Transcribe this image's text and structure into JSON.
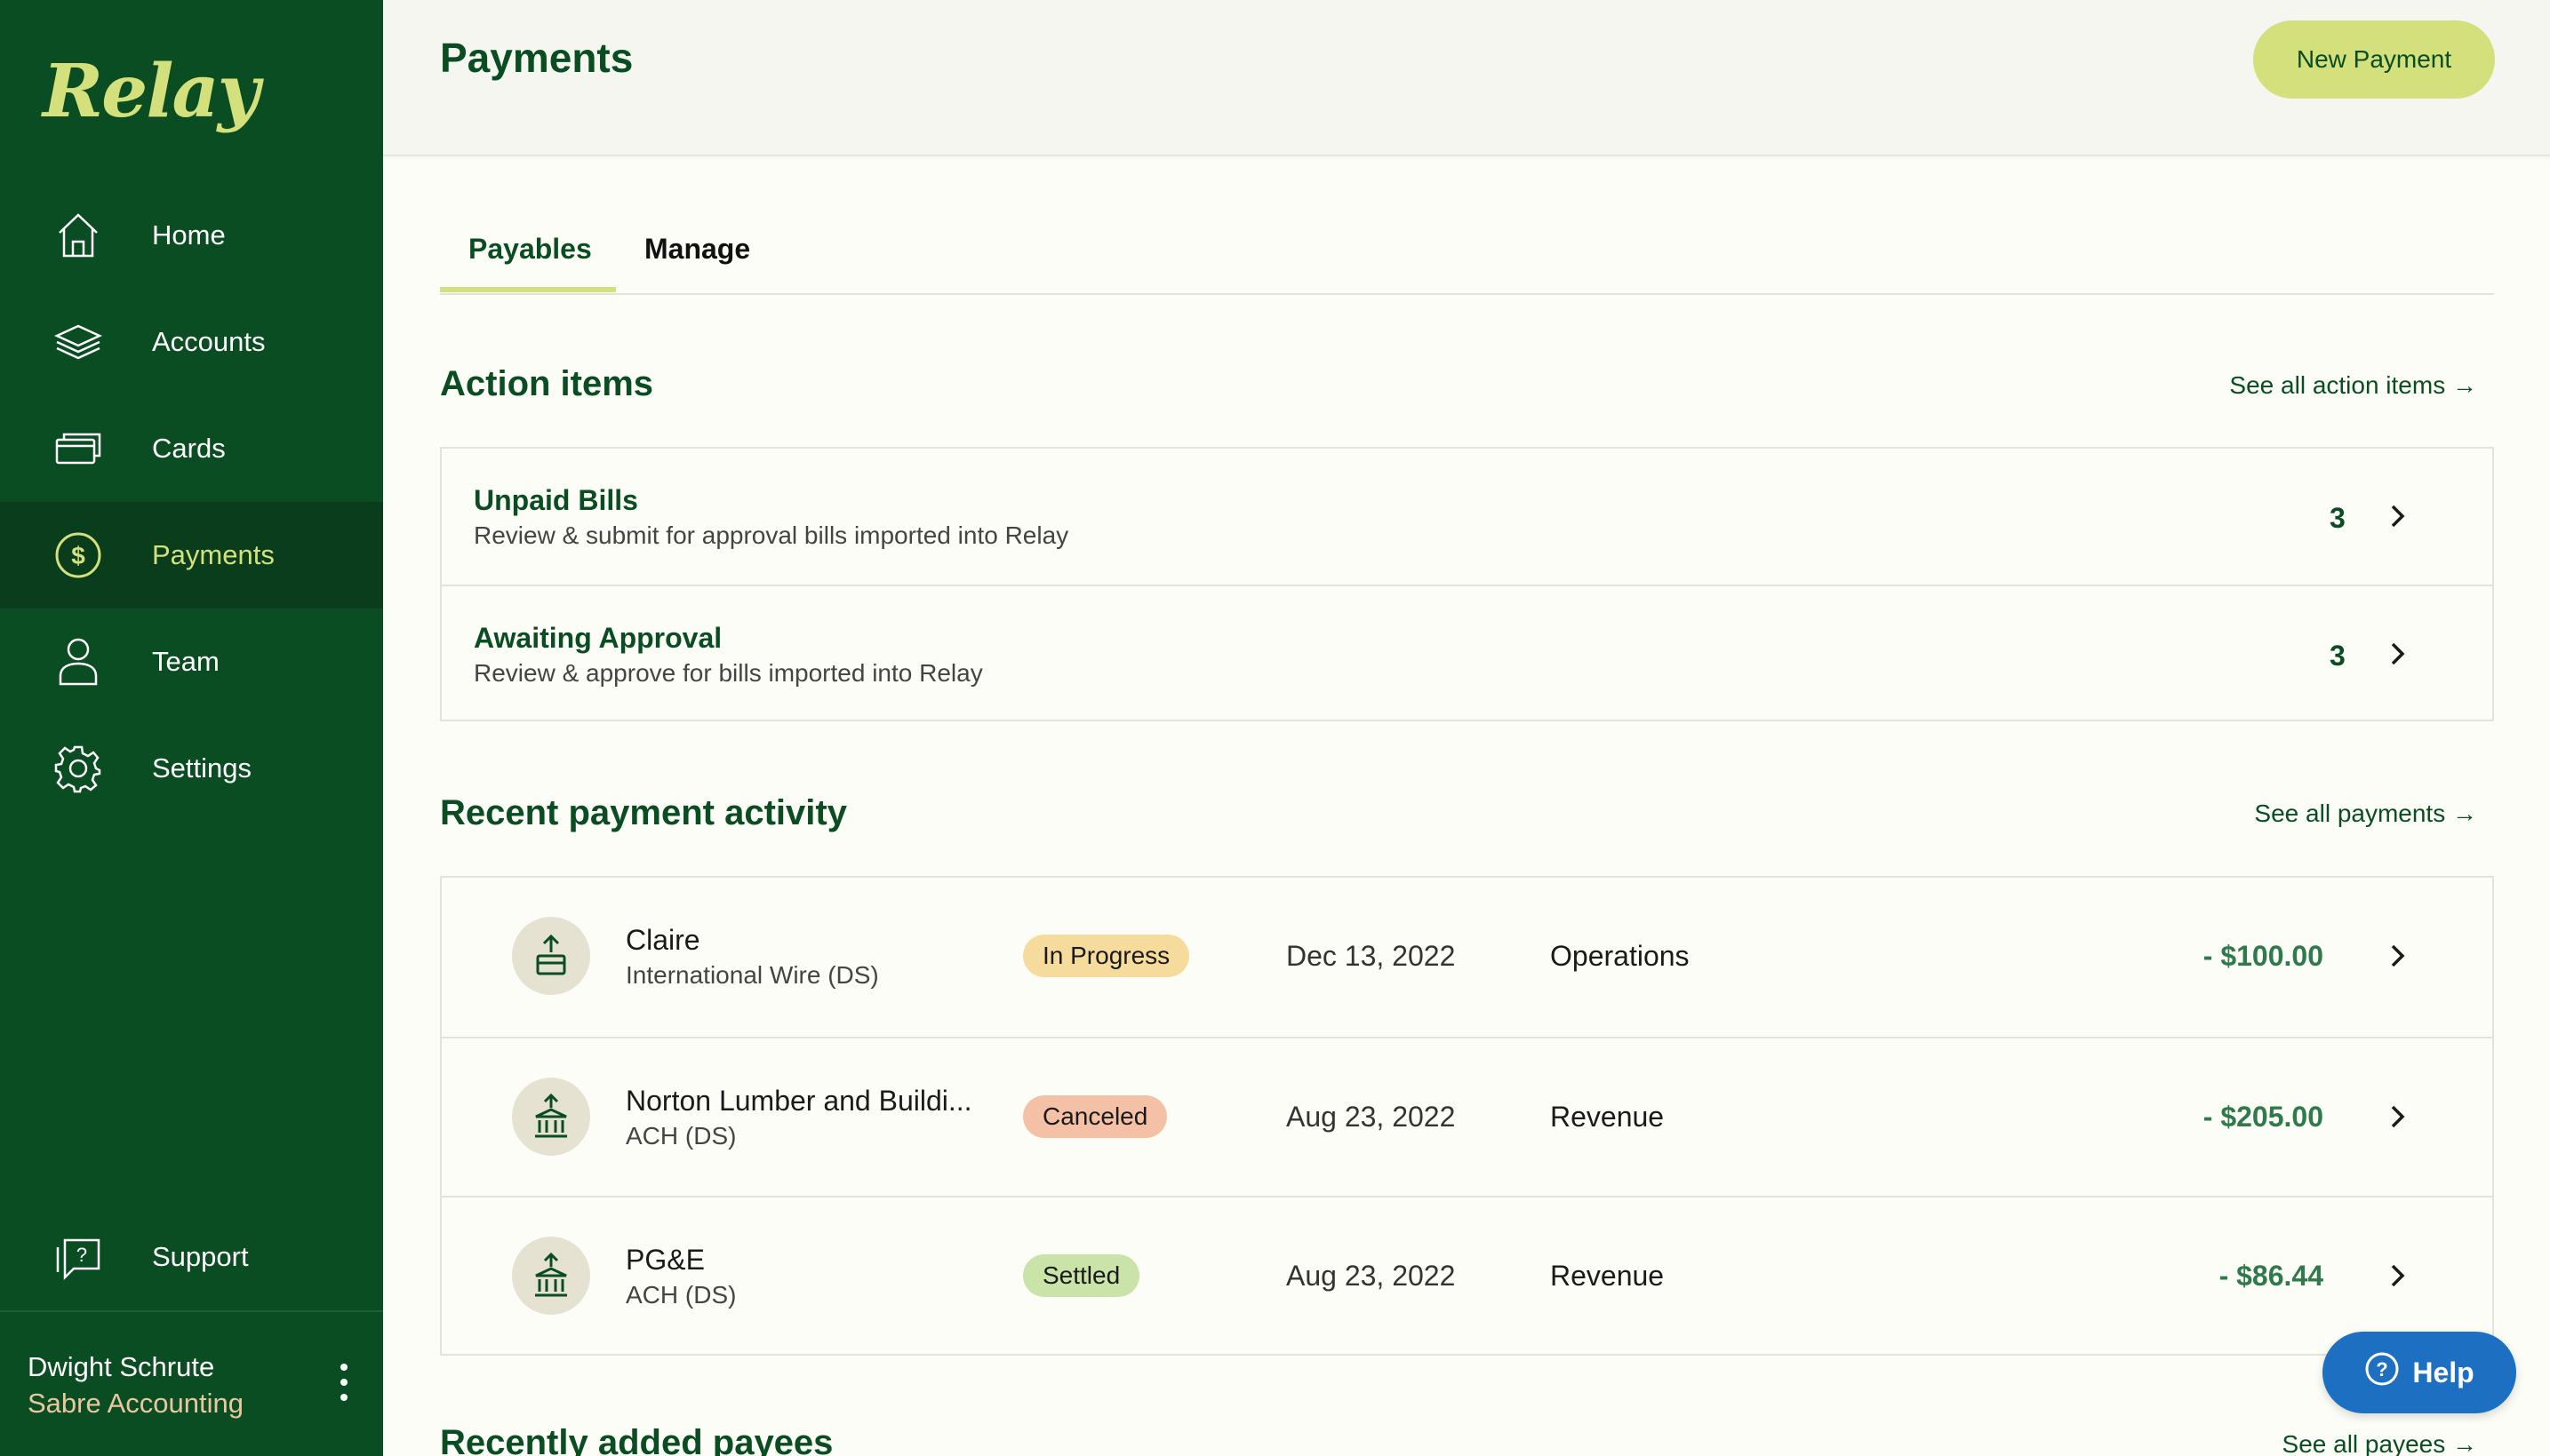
{
  "sidebar": {
    "logo": "Relay",
    "items": [
      {
        "label": "Home",
        "icon": "home-icon"
      },
      {
        "label": "Accounts",
        "icon": "layers-icon"
      },
      {
        "label": "Cards",
        "icon": "cards-icon"
      },
      {
        "label": "Payments",
        "icon": "dollar-circle-icon",
        "active": true
      },
      {
        "label": "Team",
        "icon": "person-icon"
      },
      {
        "label": "Settings",
        "icon": "gear-icon"
      }
    ],
    "support": {
      "label": "Support",
      "icon": "help-chat-icon"
    },
    "user": {
      "name": "Dwight Schrute",
      "org": "Sabre Accounting"
    }
  },
  "header": {
    "title": "Payments",
    "new_payment_label": "New Payment"
  },
  "tabs": [
    {
      "label": "Payables",
      "active": true
    },
    {
      "label": "Manage",
      "active": false
    }
  ],
  "action_items": {
    "title": "Action items",
    "see_all": "See all action items →",
    "rows": [
      {
        "title": "Unpaid Bills",
        "description": "Review & submit for approval bills imported into Relay",
        "count": "3"
      },
      {
        "title": "Awaiting Approval",
        "description": "Review & approve for bills imported into Relay",
        "count": "3"
      }
    ]
  },
  "recent_activity": {
    "title": "Recent payment activity",
    "see_all": "See all payments →",
    "rows": [
      {
        "name": "Claire",
        "method": "International Wire (DS)",
        "status": "In Progress",
        "date": "Dec 13, 2022",
        "account": "Operations",
        "amount": "- $100.00",
        "icon": "wire-transfer-icon"
      },
      {
        "name": "Norton Lumber and Buildi...",
        "method": "ACH (DS)",
        "status": "Canceled",
        "date": "Aug 23, 2022",
        "account": "Revenue",
        "amount": "- $205.00",
        "icon": "bank-transfer-icon"
      },
      {
        "name": "PG&E",
        "method": "ACH (DS)",
        "status": "Settled",
        "date": "Aug 23, 2022",
        "account": "Revenue",
        "amount": "- $86.44",
        "icon": "bank-transfer-icon"
      }
    ]
  },
  "recent_payees": {
    "title": "Recently added payees",
    "see_all": "See all payees →"
  },
  "help_label": "Help",
  "colors": {
    "sidebar_bg": "#0b4d22",
    "accent": "#d3e07b",
    "help_blue": "#1d6fc2"
  }
}
